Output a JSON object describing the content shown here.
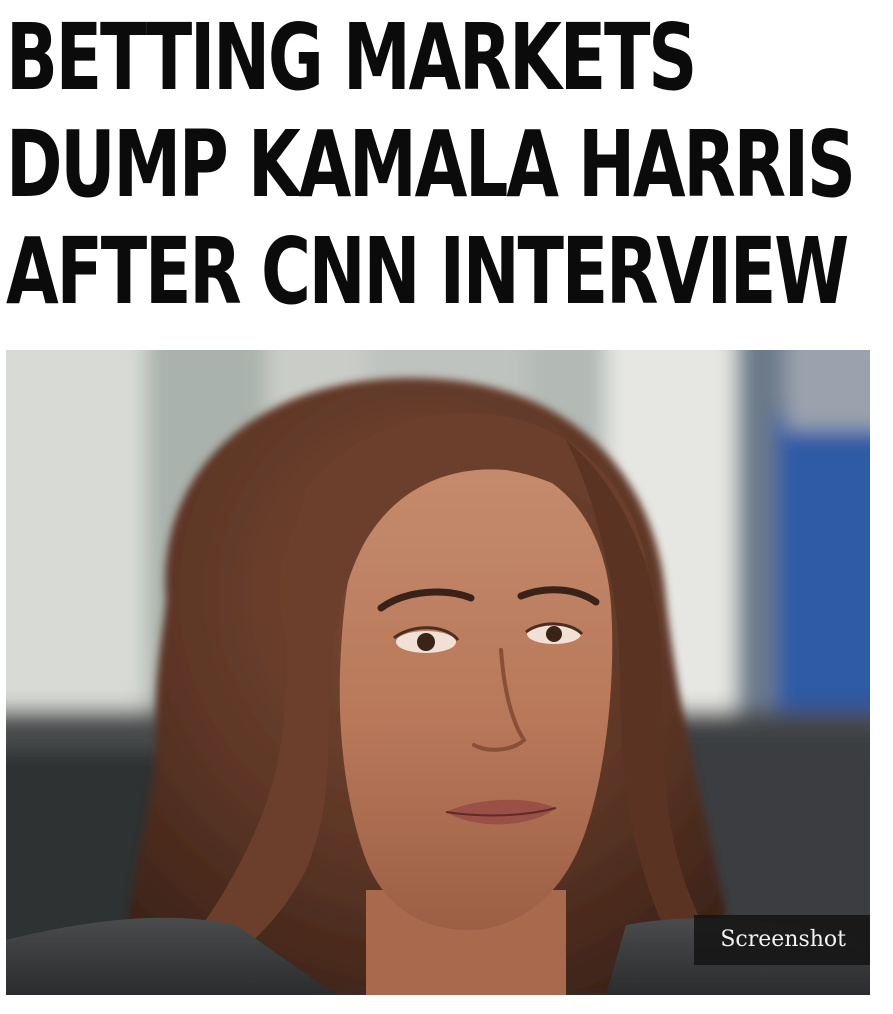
{
  "headline": {
    "lines": [
      "BETTING MARKETS",
      "DUMP KAMALA HARRIS",
      "AFTER CNN INTERVIEW"
    ]
  },
  "photo": {
    "caption": "Screenshot"
  }
}
